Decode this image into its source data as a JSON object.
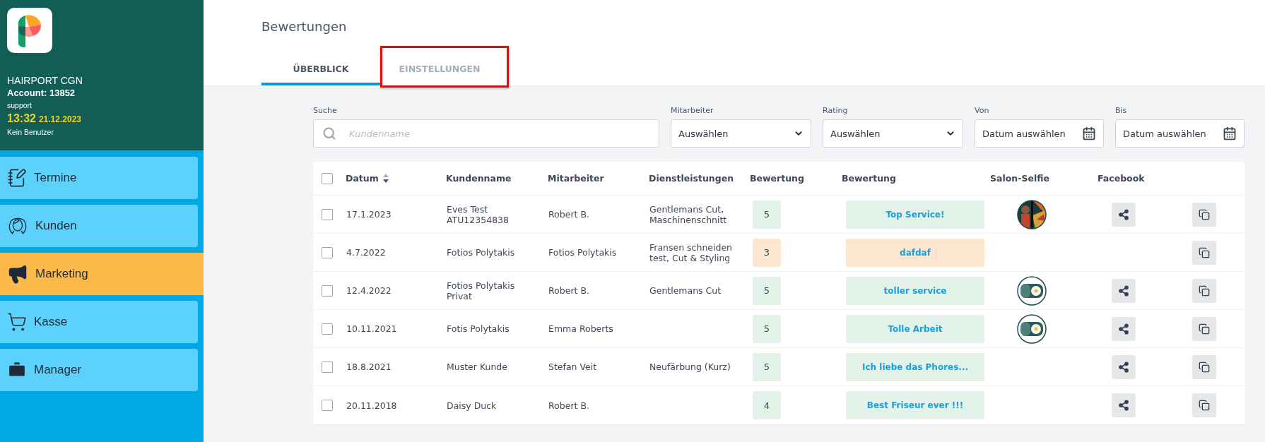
{
  "sidebar": {
    "account_name": "HAIRPORT CGN",
    "account": "Account: 13852",
    "user": "support",
    "time": "13:32",
    "date": "21.12.2023",
    "status": "Kein Benutzer",
    "nav": [
      {
        "kind": "appointments",
        "label": "Termine",
        "selected": false
      },
      {
        "kind": "customers",
        "label": "Kunden",
        "selected": false
      },
      {
        "kind": "marketing",
        "label": "Marketing",
        "selected": true
      },
      {
        "kind": "checkout",
        "label": "Kasse",
        "selected": false
      },
      {
        "kind": "manager",
        "label": "Manager",
        "selected": false
      }
    ]
  },
  "page": {
    "title": "Bewertungen"
  },
  "tabs": [
    {
      "label": "ÜBERBLICK",
      "selected": true,
      "highlighted": false
    },
    {
      "label": "EINSTELLUNGEN",
      "selected": false,
      "highlighted": true
    }
  ],
  "filters": {
    "search": {
      "label": "Suche",
      "placeholder": "Kundenname"
    },
    "fields": [
      {
        "kind": "select",
        "label": "Mitarbeiter",
        "value": "Auswählen"
      },
      {
        "kind": "select",
        "label": "Rating",
        "value": "Auswählen"
      },
      {
        "kind": "date",
        "label": "Von",
        "value": "Datum auswählen"
      },
      {
        "kind": "date",
        "label": "Bis",
        "value": "Datum auswählen"
      }
    ]
  },
  "table": {
    "select_all": {
      "checked": false
    },
    "columns": [
      {
        "label": "Datum",
        "sortable": true
      },
      {
        "label": "Kundenname",
        "sortable": false
      },
      {
        "label": "Mitarbeiter",
        "sortable": false
      },
      {
        "label": "Dienstleistungen",
        "sortable": false
      },
      {
        "label": "Bewertung",
        "sortable": false
      },
      {
        "label": "Bewertung",
        "sortable": false
      },
      {
        "label": "Salon-Selfie",
        "sortable": false
      },
      {
        "label": "Facebook",
        "sortable": false
      }
    ],
    "rows": [
      {
        "checked": false,
        "date": "17.1.2023",
        "customer": "Eves Test ATU12354838",
        "employee": "Robert B.",
        "services": "Gentlemans Cut, Maschinenschnitt",
        "rating": "5",
        "color": "#e3f2e9",
        "review": "Top Service!",
        "selfie": {
          "kind": "art"
        },
        "facebook": true
      },
      {
        "checked": false,
        "date": "4.7.2022",
        "customer": "Fotios Polytakis",
        "employee": "Fotios Polytakis",
        "services": "Fransen schneiden test, Cut & Styling",
        "rating": "3",
        "color": "#fde6d0",
        "review": "dafdaf",
        "facebook": false
      },
      {
        "checked": false,
        "date": "12.4.2022",
        "customer": "Fotios Polytakis Privat",
        "employee": "Robert B.",
        "services": "Gentlemans Cut",
        "rating": "5",
        "color": "#e3f2e9",
        "review": "toller service",
        "selfie": {
          "kind": "flower"
        },
        "facebook": true
      },
      {
        "checked": false,
        "date": "10.11.2021",
        "customer": "Fotis Polytakis",
        "employee": "Emma Roberts",
        "rating": "5",
        "color": "#e3f2e9",
        "review": "Tolle Arbeit",
        "selfie": {
          "kind": "flower"
        },
        "facebook": true
      },
      {
        "checked": false,
        "date": "18.8.2021",
        "customer": "Muster Kunde",
        "employee": "Stefan Veit",
        "services": "Neufärbung (Kurz)",
        "rating": "5",
        "color": "#e3f2e9",
        "review": "Ich liebe das Phores...",
        "facebook": true
      },
      {
        "checked": false,
        "date": "20.11.2018",
        "customer": "Daisy Duck",
        "employee": "Robert B.",
        "rating": "4",
        "color": "#e3f2e9",
        "review": "Best Friseur ever !!!",
        "facebook": true
      }
    ]
  }
}
